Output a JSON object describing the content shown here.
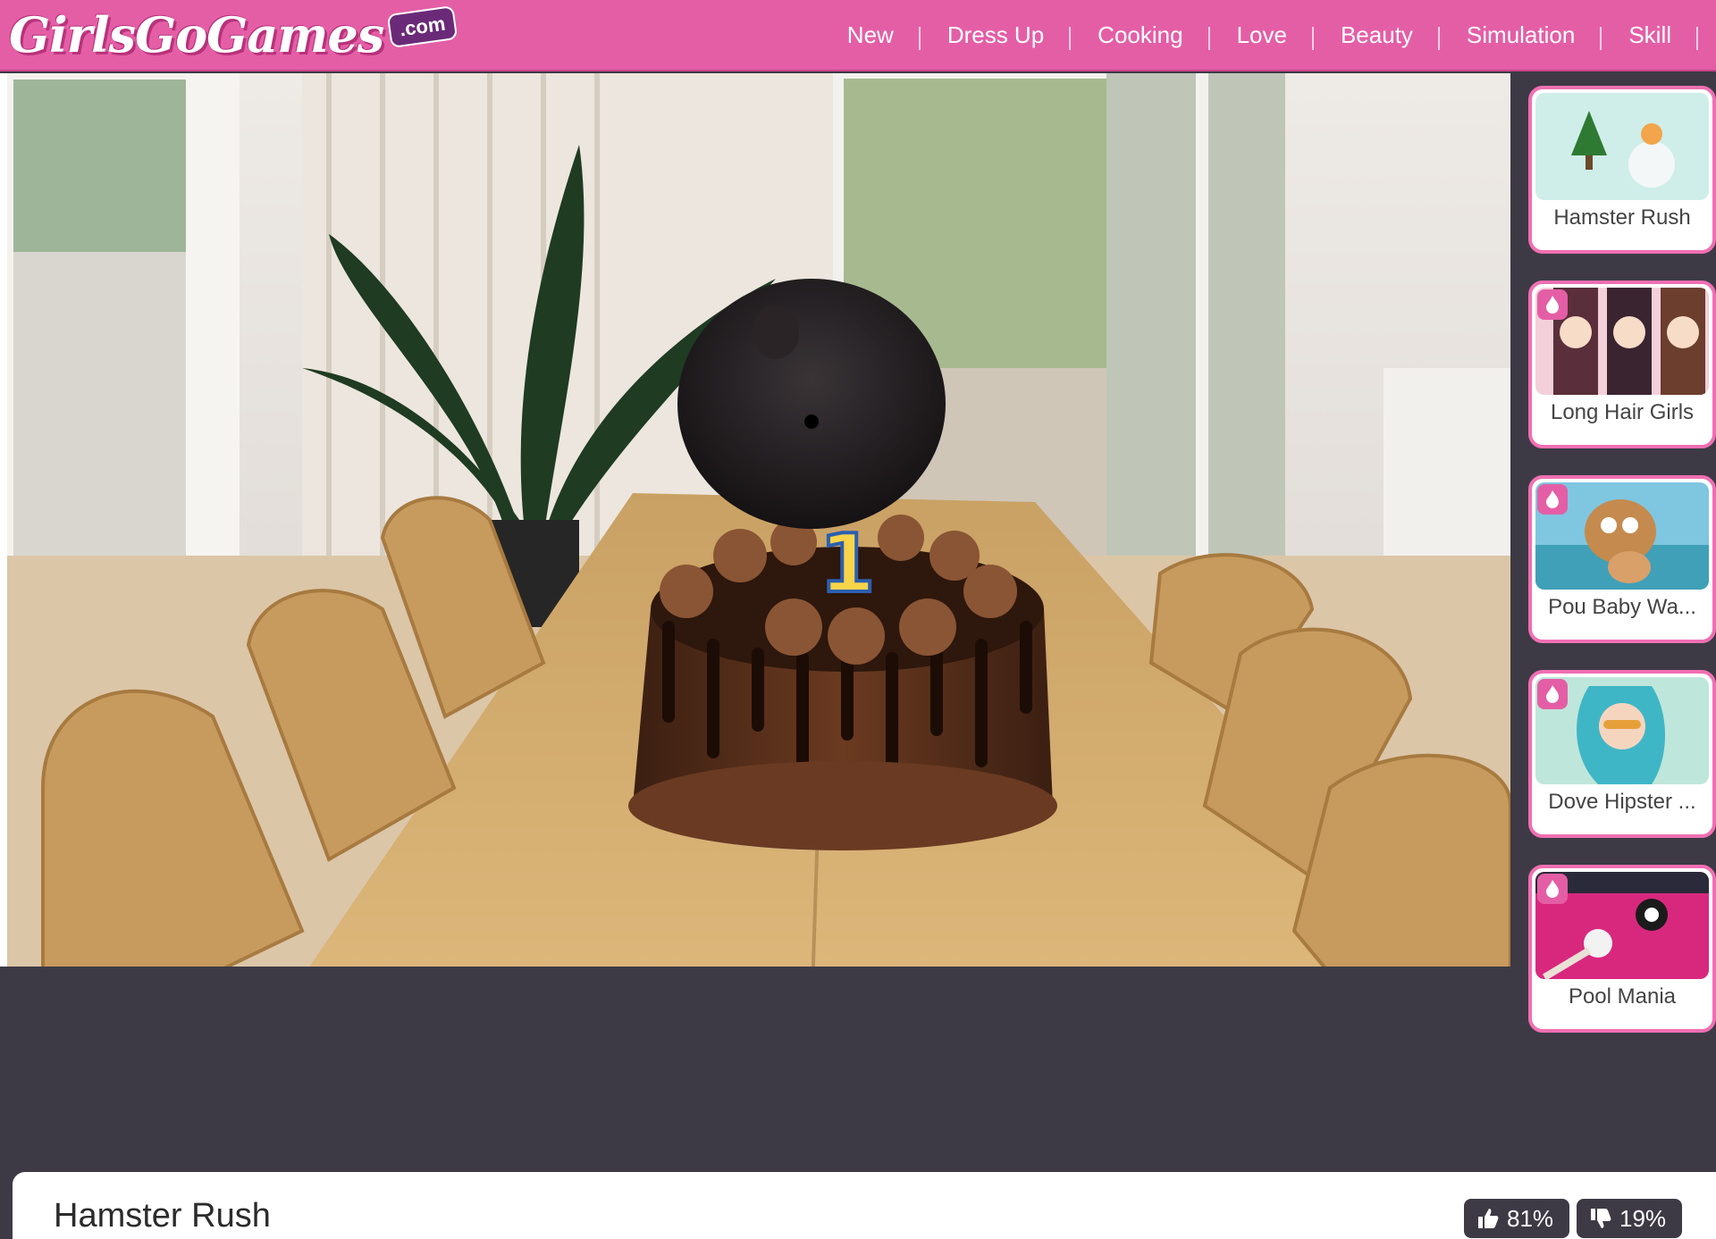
{
  "header": {
    "logo_text": "GirlsGoGames",
    "logo_badge": ".com",
    "nav": [
      "New",
      "Dress Up",
      "Cooking",
      "Love",
      "Beauty",
      "Simulation",
      "Skill"
    ]
  },
  "scene": {
    "candle_number": "1"
  },
  "sidebar": {
    "cards": [
      {
        "label": "Hamster Rush"
      },
      {
        "label": "Long Hair Girls"
      },
      {
        "label": "Pou Baby Wa..."
      },
      {
        "label": "Dove Hipster ..."
      },
      {
        "label": "Pool Mania"
      }
    ]
  },
  "game": {
    "title": "Hamster Rush",
    "likes": "81%",
    "dislikes": "19%"
  },
  "colors": {
    "brand_pink": "#e45ea6",
    "card_border": "#f06fb2",
    "dark": "#3d3a45"
  }
}
